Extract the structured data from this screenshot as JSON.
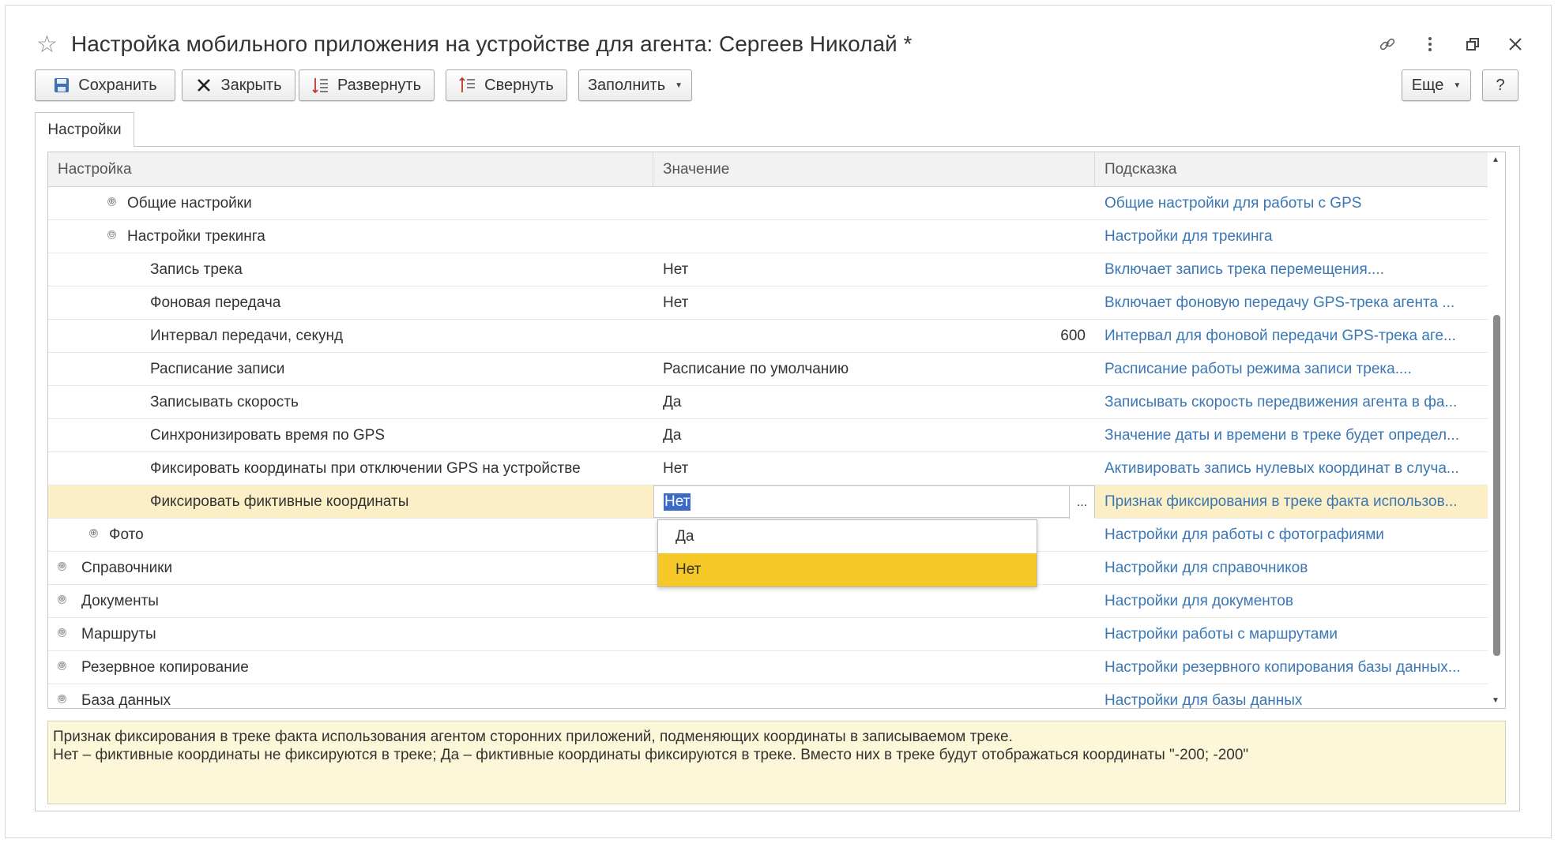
{
  "window": {
    "title": "Настройка мобильного приложения на устройстве для агента: Сергеев Николай *"
  },
  "toolbar": {
    "save_label": "Сохранить",
    "close_label": "Закрыть",
    "expand_label": "Развернуть",
    "collapse_label": "Свернуть",
    "fill_label": "Заполнить",
    "more_label": "Еще",
    "help_label": "?"
  },
  "tabs": [
    {
      "label": "Настройки"
    }
  ],
  "grid": {
    "columns": [
      "Настройка",
      "Значение",
      "Подсказка"
    ],
    "rows": [
      {
        "name": "Общие настройки",
        "value": "",
        "hint": "Общие настройки для работы с GPS",
        "expander": "⊕"
      },
      {
        "name": "Настройки трекинга",
        "value": "",
        "hint": "Настройки для трекинга",
        "expander": "⊖"
      },
      {
        "name": "Запись трека",
        "value": "Нет",
        "hint": "Включает запись трека перемещения...."
      },
      {
        "name": "Фоновая передача",
        "value": "Нет",
        "hint": "Включает фоновую передачу GPS-трека агента ..."
      },
      {
        "name": "Интервал передачи, секунд",
        "value": "600",
        "hint": "Интервал для фоновой передачи GPS-трека аге..."
      },
      {
        "name": "Расписание записи",
        "value": "Расписание по умолчанию",
        "hint": "Расписание работы режима записи трека...."
      },
      {
        "name": "Записывать скорость",
        "value": "Да",
        "hint": "Записывать скорость передвижения агента в фа..."
      },
      {
        "name": "Синхронизировать время по GPS",
        "value": "Да",
        "hint": "Значение даты и времени в треке будет определ..."
      },
      {
        "name": "Фиксировать координаты при отключении GPS на устройстве",
        "value": "Нет",
        "hint": "Активировать запись нулевых координат в случа..."
      },
      {
        "name": "Фиксировать фиктивные координаты",
        "value": "Нет",
        "hint": "Признак фиксирования в треке факта использов..."
      },
      {
        "name": "Фото",
        "value": "",
        "hint": "Настройки для работы с фотографиями",
        "expander": "⊕"
      },
      {
        "name": "Справочники",
        "value": "",
        "hint": "Настройки для справочников",
        "expander": "⊕"
      },
      {
        "name": "Документы",
        "value": "",
        "hint": "Настройки для документов",
        "expander": "⊕"
      },
      {
        "name": "Маршруты",
        "value": "",
        "hint": "Настройки работы с маршрутами",
        "expander": "⊕"
      },
      {
        "name": "Резервное копирование",
        "value": "",
        "hint": "Настройки резервного копирования базы данных...",
        "expander": "⊕"
      },
      {
        "name": "База данных",
        "value": "",
        "hint": "Настройки для базы данных",
        "expander": "⊕"
      }
    ],
    "selected_row": 9,
    "ellipsis_label": "..."
  },
  "dropdown": {
    "options": [
      "Да",
      "Нет"
    ],
    "selected": "Нет"
  },
  "hint_panel": {
    "line1": "Признак фиксирования в треке факта использования агентом сторонних приложений, подменяющих координаты в записываемом треке.",
    "line2": "Нет – фиктивные координаты не фиксируются в треке; Да – фиктивные координаты фиксируются в треке. Вместо них в треке будут отображаться координаты \"-200; -200\""
  },
  "colors": {
    "hint_link": "#3a77b5",
    "selected_row_bg": "#fcefc6",
    "dropdown_active": "#f6c827",
    "hint_panel_bg": "#fdf7d9"
  }
}
